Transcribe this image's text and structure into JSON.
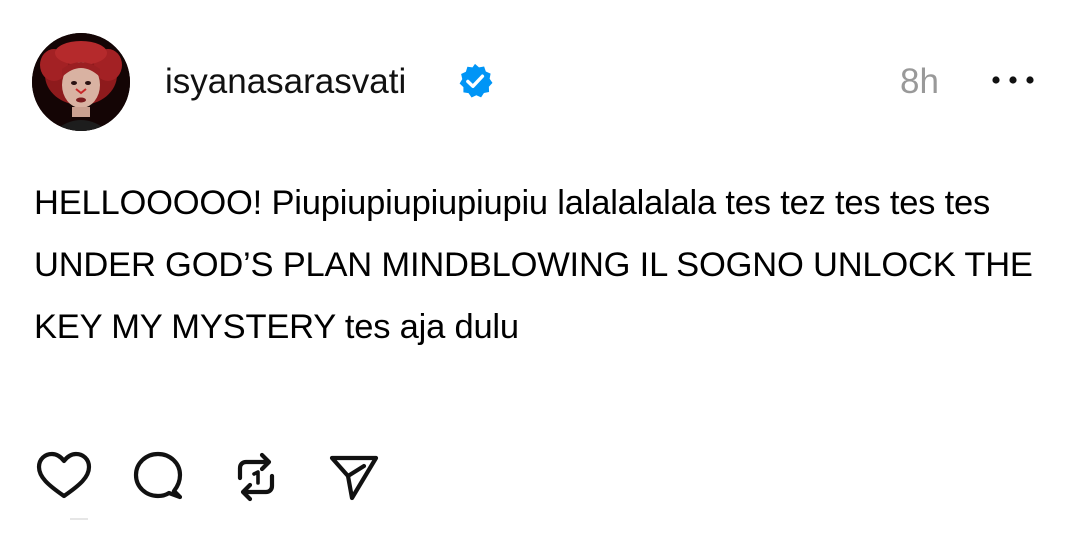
{
  "post": {
    "author": {
      "username": "isyanasarasvati",
      "verified": true,
      "avatar_icon": "profile-avatar-icon"
    },
    "timestamp": "8h",
    "text": "HELLOOOOO! Piupiupiupiupiupiu lalalalalala tes tez tes tes tes UNDER GOD’S PLAN MINDBLOWING IL SOGNO UNLOCK THE KEY MY MYSTERY tes aja dulu",
    "actions": [
      {
        "name": "like",
        "icon": "heart-icon"
      },
      {
        "name": "comment",
        "icon": "comment-icon"
      },
      {
        "name": "repost",
        "icon": "repost-icon"
      },
      {
        "name": "share",
        "icon": "send-icon"
      }
    ],
    "colors": {
      "verified_badge": "#0095f6",
      "timestamp": "#999999",
      "text": "#000000"
    }
  }
}
